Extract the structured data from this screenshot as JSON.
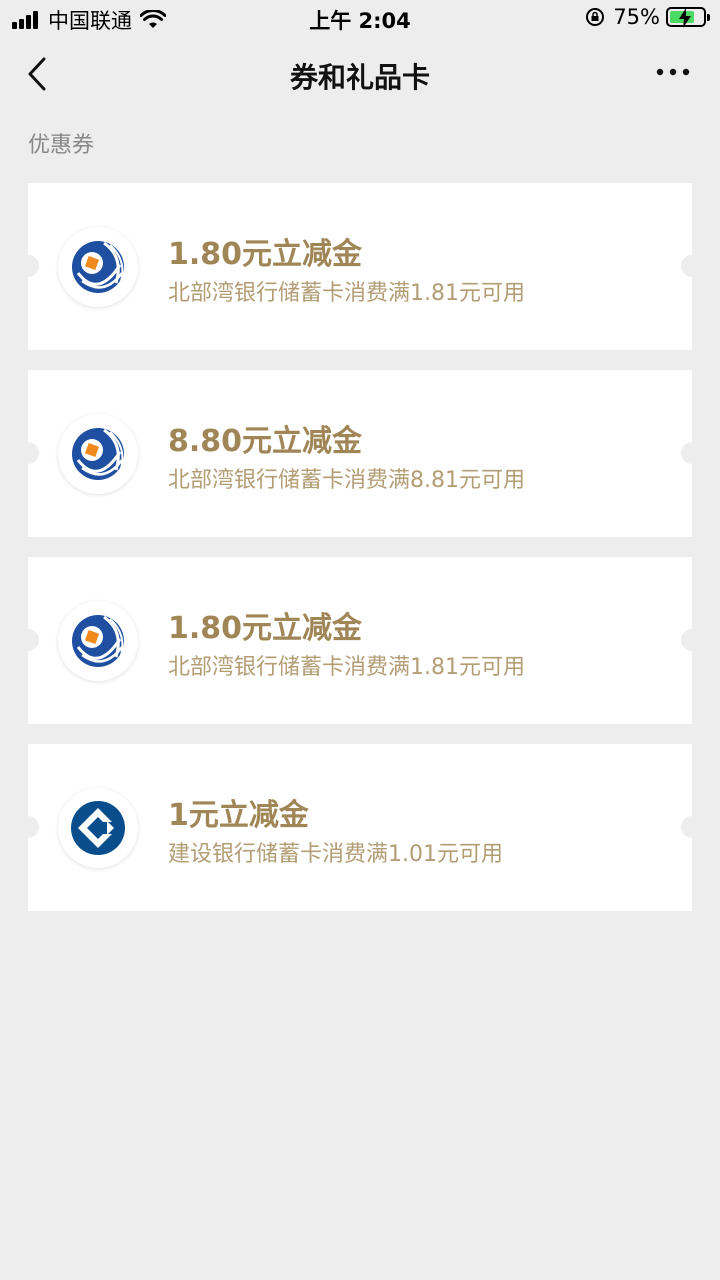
{
  "status_bar": {
    "carrier": "中国联通",
    "time": "上午 2:04",
    "battery": "75%",
    "battery_level": 0.75
  },
  "nav": {
    "title": "券和礼品卡"
  },
  "section": {
    "label": "优惠券"
  },
  "coupons": [
    {
      "amount": "1.80元立减金",
      "desc": "北部湾银行储蓄卡消费满1.81元可用",
      "bank_icon": "beibu-gulf-bank-logo"
    },
    {
      "amount": "8.80元立减金",
      "desc": "北部湾银行储蓄卡消费满8.81元可用",
      "bank_icon": "beibu-gulf-bank-logo"
    },
    {
      "amount": "1.80元立减金",
      "desc": "北部湾银行储蓄卡消费满1.81元可用",
      "bank_icon": "beibu-gulf-bank-logo"
    },
    {
      "amount": "1元立减金",
      "desc": "建设银行储蓄卡消费满1.01元可用",
      "bank_icon": "ccb-bank-logo"
    }
  ],
  "colors": {
    "background": "#ededed",
    "accent_gold": "#a08656",
    "beibu_blue": "#1f4fa0",
    "beibu_orange": "#f08a1c",
    "ccb_blue": "#0a4d8c"
  }
}
